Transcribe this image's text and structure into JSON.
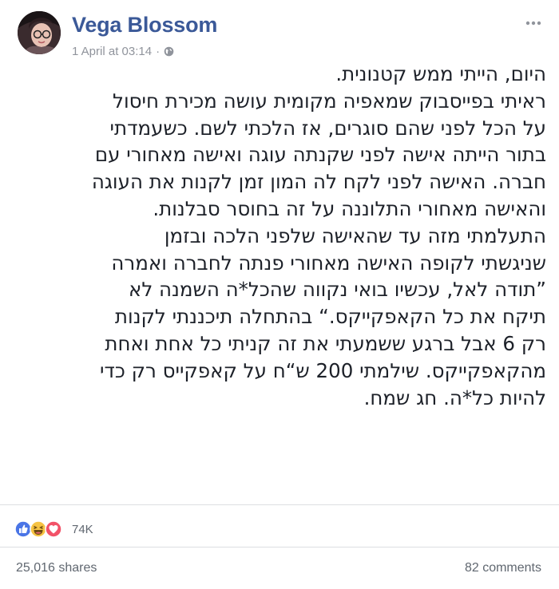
{
  "post": {
    "author": "Vega Blossom",
    "timestamp": "1 April at 03:14",
    "separator": "·",
    "audience_icon": "globe-icon",
    "body_lines": [
      "היום, הייתי ממש קטנונית.",
      "ראיתי בפייסבוק שמאפיה מקומית עושה מכירת חיסול",
      "על הכל לפני שהם סוגרים, אז הלכתי לשם. כשעמדתי",
      "בתור הייתה אישה לפני שקנתה עוגה ואישה מאחורי עם",
      "חברה. האישה לפני לקח לה המון זמן לקנות את העוגה",
      "והאישה מאחורי התלוננה על זה בחוסר סבלנות.",
      "התעלמתי מזה עד שהאישה שלפני הלכה ובזמן",
      "שניגשתי לקופה האישה מאחורי פנתה לחברה ואמרה",
      "”תודה לאל, עכשיו בואי נקווה שהכל*ה השמנה לא",
      "תיקח את כל הקאפקייקס.“ בהתחלה תיכננתי לקנות",
      "רק 6 אבל ברגע ששמעתי את זה קניתי כל אחת ואחת",
      "מהקאפקייקס. שילמתי 200 ש“ח על קאפקייס רק כדי",
      "להיות כל*ה. חג שמח."
    ]
  },
  "reactions": {
    "icons": [
      "like-icon",
      "haha-icon",
      "love-icon"
    ],
    "count": "74K"
  },
  "footer": {
    "shares": "25,016 shares",
    "comments": "82 comments"
  },
  "colors": {
    "author": "#3b5998",
    "like": "#4a75e6",
    "haha": "#f6c343",
    "love": "#f25268",
    "meta": "#90949c"
  }
}
